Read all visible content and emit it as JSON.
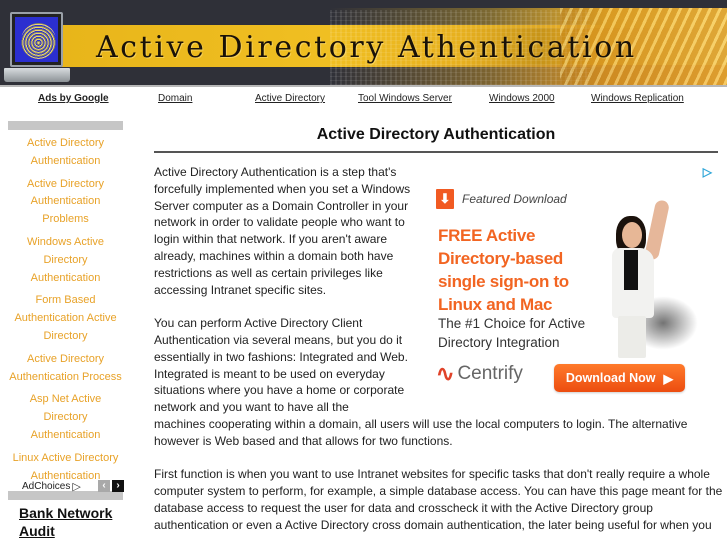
{
  "banner": {
    "title": "Active Directory Athentication",
    "image_alt": "laptop-fingerprint"
  },
  "topnav": {
    "ads_label": "Ads by Google",
    "links": [
      "Domain",
      "Active Directory",
      "Tool Windows Server",
      "Windows 2000",
      "Windows Replication"
    ]
  },
  "sidebar": {
    "links": [
      "Active Directory Authentication",
      "Active Directory Authentication Problems",
      "Windows Active Directory Authentication",
      "Form Based Authentication Active Directory",
      "Active Directory Authentication Process",
      "Asp Net Active Directory Authentication",
      "Linux Active Directory Authentication"
    ],
    "adchoices_label": "AdChoices",
    "adchoices_icon": "▷",
    "prev_icon": "‹",
    "next_icon": "›",
    "ad_link": "Bank Network Audit"
  },
  "main": {
    "title": "Active Directory Authentication",
    "paragraphs": [
      "Active Directory Authentication is a step that's forcefully implemented when you set a Windows Server computer as a Domain Controller in your network in order to validate people who want to login within that network. If you aren't aware already, machines within a domain both have restrictions as well as certain privileges like accessing Intranet specific sites.",
      "You can perform Active Directory Client Authentication via several means, but you do it essentially in two fashions: Integrated and Web. Integrated is meant to be used on everyday situations where you have a home or corporate network and you want to have all the",
      "machines cooperating within a domain, all users will use the local computers to login. The alternative however is Web based and that allows for two functions.",
      "First function is when you want to use Intranet websites for specific tasks that don't really require a whole computer system to perform, for example, a simple database access. You can have this page meant for the database access to request the user for data and crosscheck it with the Active Directory group authentication or even a Active Directory cross domain authentication, the later being useful for when you"
    ]
  },
  "ad": {
    "featured": "Featured Download",
    "headline": "FREE Active Directory-based single sign-on to Linux and Mac",
    "subline": "The #1 Choice for Active Directory Integration",
    "brand": "Centrify",
    "brand_mark": "®",
    "cta": "Download Now",
    "cta_icon": "▶",
    "download_icon": "⬇",
    "adchoice_icon": "▷",
    "colors": {
      "accent": "#f26522",
      "button": "#f15a22",
      "sidebar_link": "#e8a228"
    }
  }
}
